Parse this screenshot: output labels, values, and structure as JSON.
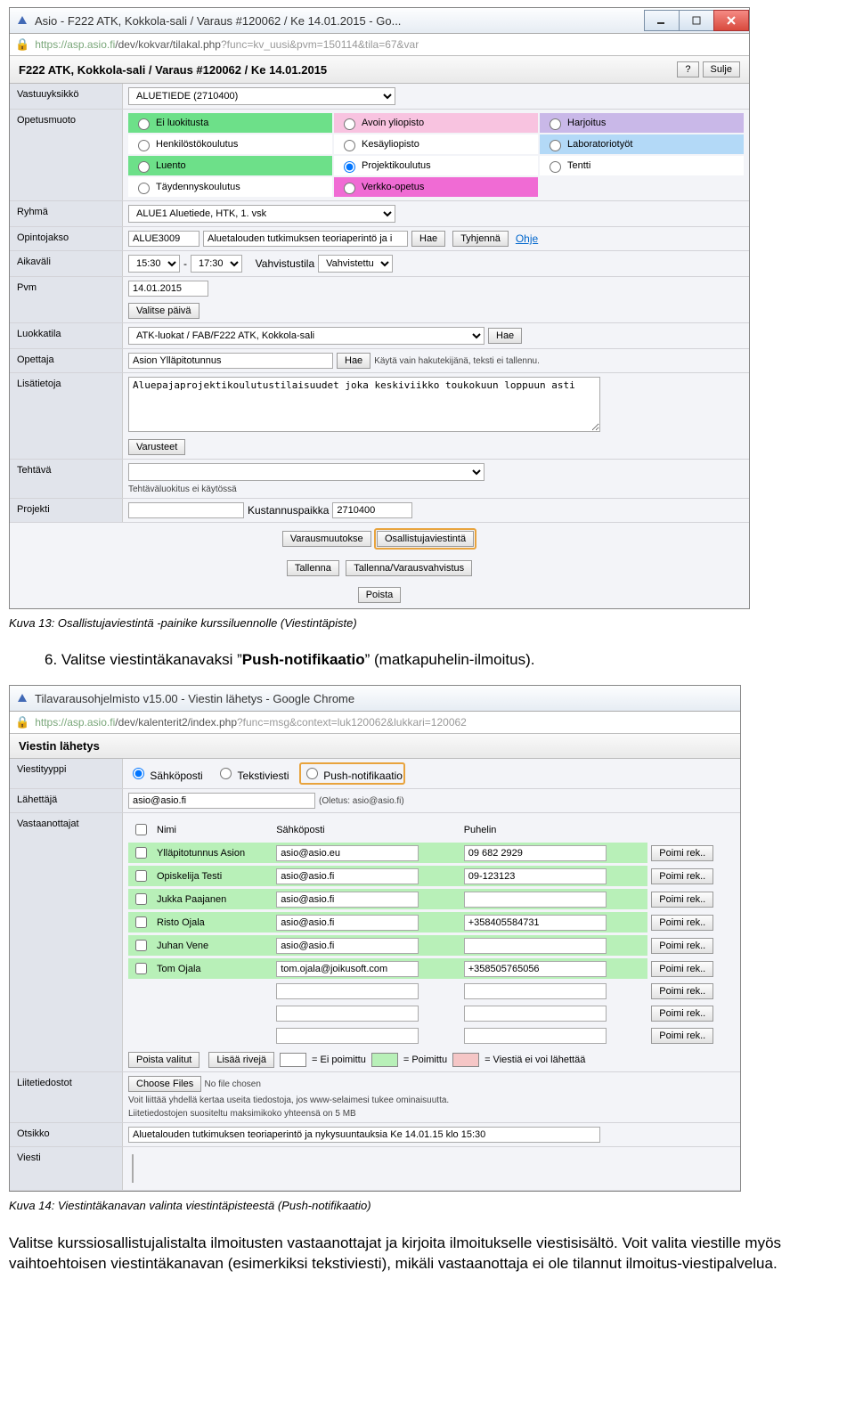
{
  "win1": {
    "title": "Asio - F222 ATK, Kokkola-sali / Varaus #120062 / Ke 14.01.2015 - Go...",
    "url_host": "https://asp.asio.fi",
    "url_path": "/dev/kokvar/tilakal.php",
    "url_query": "?func=kv_uusi&pvm=150114&tila=67&var",
    "heading": "F222 ATK, Kokkola-sali / Varaus #120062 / Ke 14.01.2015",
    "help_btn": "?",
    "close_btn": "Sulje",
    "rows": {
      "vastuuyksikko_lbl": "Vastuuyksikkö",
      "vastuuyksikko_val": "ALUETIEDE (2710400)",
      "opetusmuoto_lbl": "Opetusmuoto",
      "radios": {
        "o1": "Ei luokitusta",
        "o2": "Avoin yliopisto",
        "o3": "Harjoitus",
        "o4": "Henkilöstökoulutus",
        "o5": "Kesäyliopisto",
        "o6": "Laboratoriotyöt",
        "o7": "Luento",
        "o8": "Projektikoulutus",
        "o9": "Tentti",
        "o10": "Täydennyskoulutus",
        "o11": "Verkko-opetus"
      },
      "ryhma_lbl": "Ryhmä",
      "ryhma_val": "ALUE1 Aluetiede, HTK, 1. vsk",
      "opintojakso_lbl": "Opintojakso",
      "opintojakso_code": "ALUE3009",
      "opintojakso_desc": "Aluetalouden tutkimuksen teoriaperintö ja i",
      "hae": "Hae",
      "tyhjenna": "Tyhjennä",
      "ohje": "Ohje",
      "aikavali_lbl": "Aikaväli",
      "t1": "15:30",
      "t2": "17:30",
      "vahvistustila_lbl": "Vahvistustila",
      "vahvistustila_val": "Vahvistettu",
      "pvm_lbl": "Pvm",
      "pvm_val": "14.01.2015",
      "valitse_paiva": "Valitse päivä",
      "luokkatila_lbl": "Luokkatila",
      "luokkatila_val": "ATK-luokat / FAB/F222 ATK, Kokkola-sali",
      "opettaja_lbl": "Opettaja",
      "opettaja_val": "Asion Ylläpitotunnus",
      "opettaja_hint": "Käytä vain hakutekijänä, teksti ei tallennu.",
      "lisatietoja_lbl": "Lisätietoja",
      "lisatietoja_val": "Aluepajaprojektikoulutustilaisuudet joka keskiviikko toukokuun loppuun asti",
      "varusteet": "Varusteet",
      "tehtava_lbl": "Tehtävä",
      "tehtava_note": "Tehtäväluokitus ei käytössä",
      "projekti_lbl": "Projekti",
      "kustannuspaikka_lbl": "Kustannuspaikka",
      "kustannuspaikka_val": "2710400",
      "varausmuutokse": "Varausmuutokse",
      "osallistuja": "Osallistujaviestintä",
      "tallenna": "Tallenna",
      "tallennavahv": "Tallenna/Varausvahvistus",
      "poista": "Poista"
    }
  },
  "caption1": "Kuva 13: Osallistujaviestintä -painike kurssiluennolle (Viestintäpiste)",
  "instr6": "6.   Valitse viestintäkanavaksi ”",
  "instr6b": "Push-notifikaatio",
  "instr6c": "” (matkapuhelin-ilmoitus).",
  "win2": {
    "title": "Tilavarausohjelmisto v15.00 - Viestin lähetys - Google Chrome",
    "url_host": "https://asp.asio.fi",
    "url_path": "/dev/kalenterit2/index.php",
    "url_query": "?func=msg&context=luk120062&lukkari=120062",
    "heading": "Viestin lähetys",
    "vt_lbl": "Viestityyppi",
    "vt_email": "Sähköposti",
    "vt_sms": "Tekstiviesti",
    "vt_push": "Push-notifikaatio",
    "lah_lbl": "Lähettäjä",
    "lah_val": "asio@asio.fi",
    "lah_def": "(Oletus: asio@asio.fi)",
    "vast_lbl": "Vastaanottajat",
    "col_nimi": "Nimi",
    "col_email": "Sähköposti",
    "col_puh": "Puhelin",
    "poimi": "Poimi rek..",
    "rows": [
      {
        "n": "Ylläpitotunnus Asion",
        "e": "asio@asio.eu",
        "p": "09 682 2929"
      },
      {
        "n": "Opiskelija Testi",
        "e": "asio@asio.fi",
        "p": "09-123123"
      },
      {
        "n": "Jukka Paajanen",
        "e": "asio@asio.fi",
        "p": ""
      },
      {
        "n": "Risto Ojala",
        "e": "asio@asio.fi",
        "p": "+358405584731"
      },
      {
        "n": "Juhan Vene",
        "e": "asio@asio.fi",
        "p": ""
      },
      {
        "n": "Tom Ojala",
        "e": "tom.ojala@joikusoft.com",
        "p": "+358505765056"
      }
    ],
    "poista_valitut": "Poista valitut",
    "lisaa_riveja": "Lisää rivejä",
    "leg1": "= Ei poimittu",
    "leg2": "= Poimittu",
    "leg3": "= Viestiä ei voi lähettää",
    "liite_lbl": "Liitetiedostot",
    "choose": "Choose Files",
    "nofile": "No file chosen",
    "liite_note1": "Voit liittää yhdellä kertaa useita tiedostoja, jos www-selaimesi tukee ominaisuutta.",
    "liite_note2": "Liitetiedostojen suositeltu maksimikoko yhteensä on 5 MB",
    "otsikko_lbl": "Otsikko",
    "otsikko_val": "Aluetalouden tutkimuksen teoriaperintö ja nykysuuntauksia Ke 14.01.15 klo 15:30",
    "viesti_lbl": "Viesti"
  },
  "caption2": "Kuva 14: Viestintäkanavan valinta viestintäpisteestä (Push-notifikaatio)",
  "body1": "Valitse kurssiosallistujalistalta ilmoitusten vastaanottajat ja kirjoita ilmoitukselle viestisisältö. Voit valita viestille myös vaihtoehtoisen viestintäkanavan (esimerkiksi tekstiviesti), mikäli vastaanottaja ei ole tilannut ilmoitus-viestipalvelua."
}
